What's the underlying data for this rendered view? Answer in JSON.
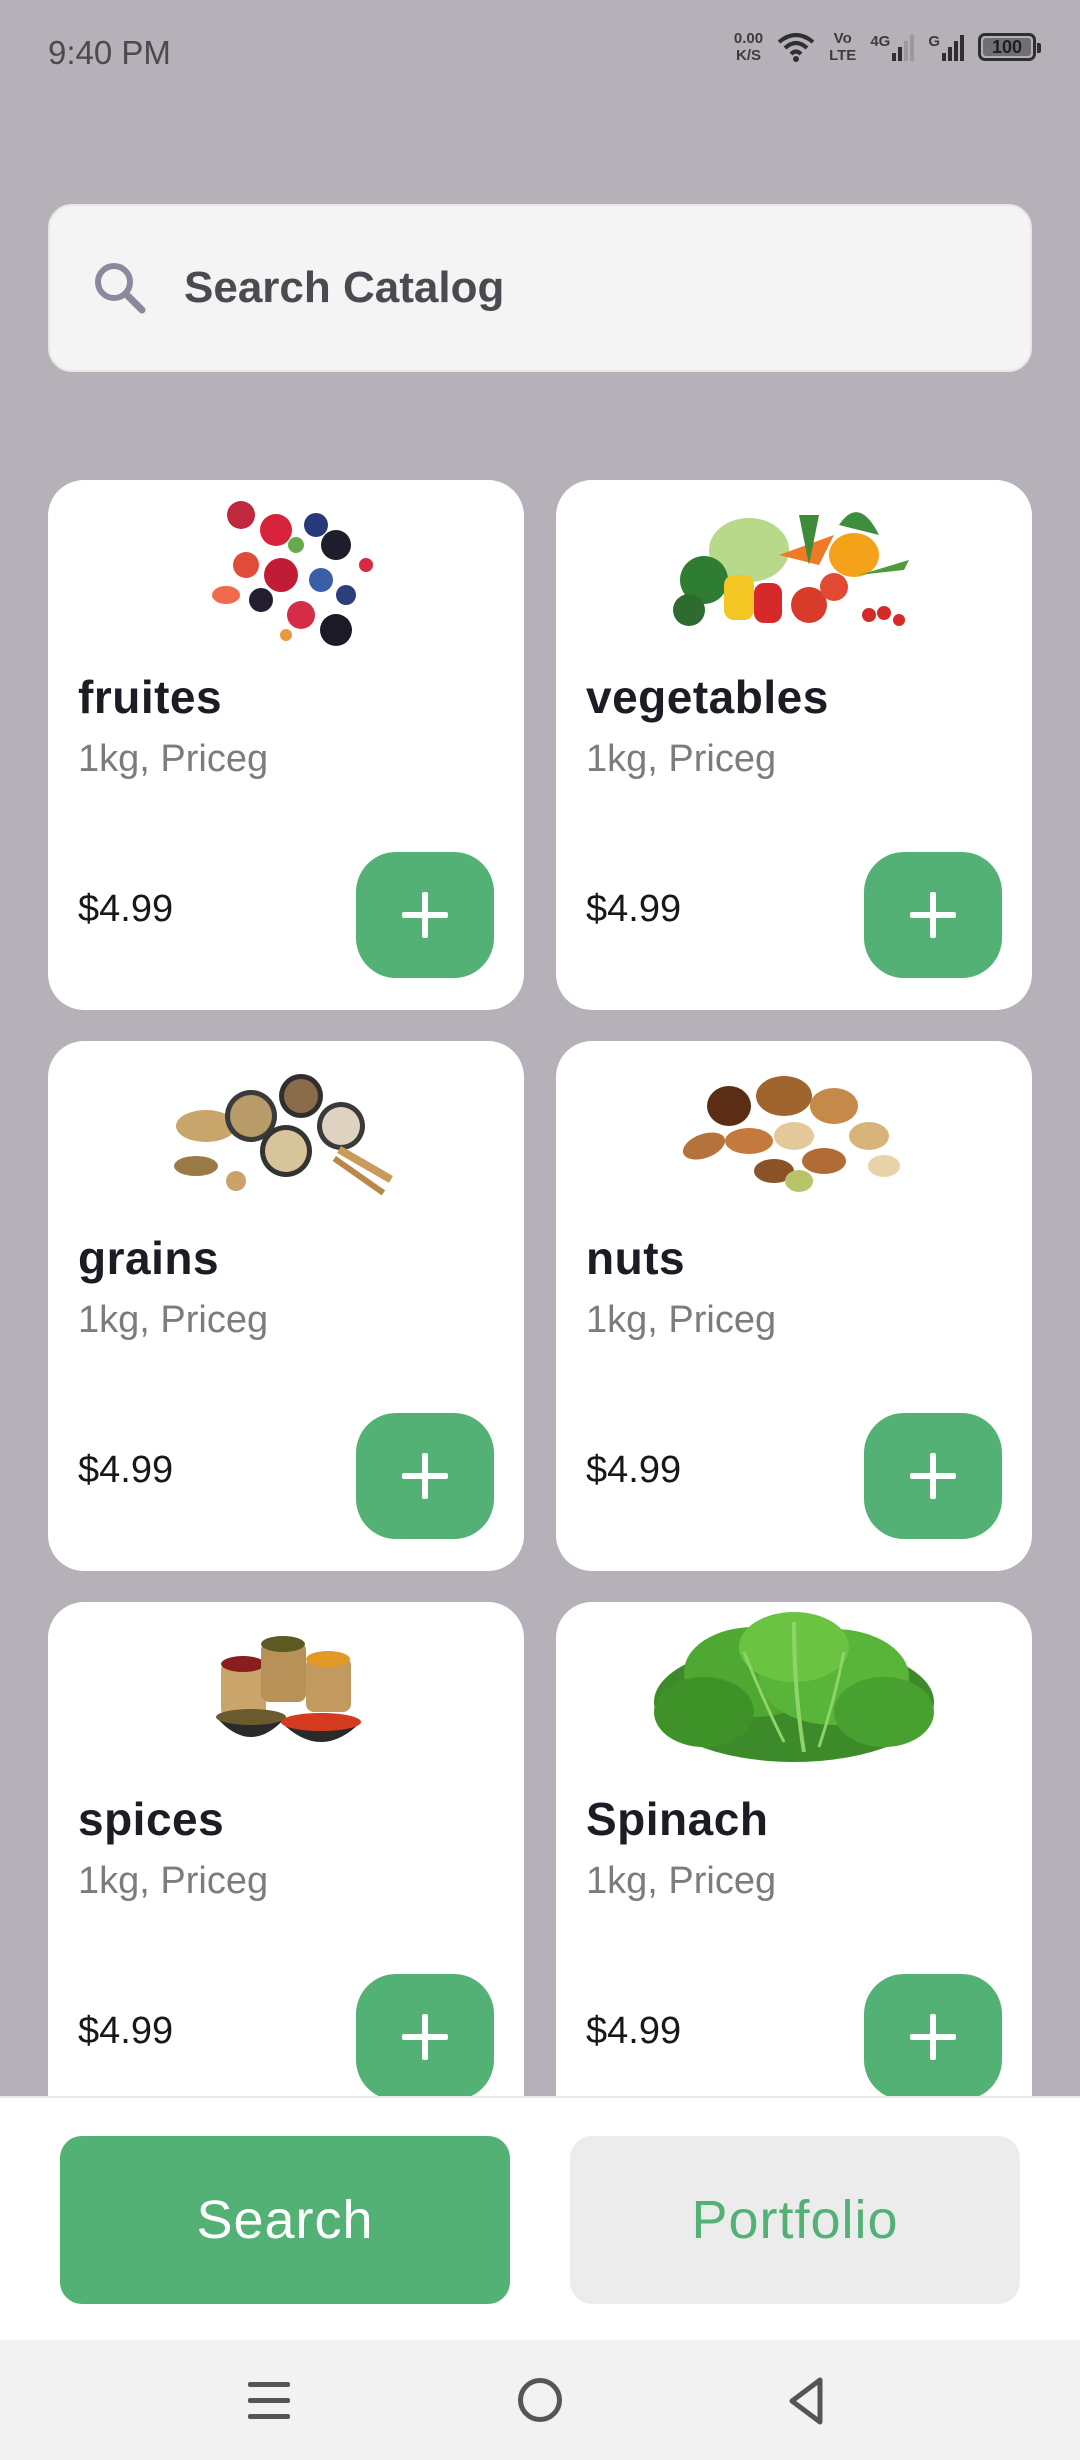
{
  "status_bar": {
    "time": "9:40 PM",
    "net_speed_value": "0.00",
    "net_speed_unit": "K/S",
    "volte_top": "Vo",
    "volte_bottom": "LTE",
    "network_4g": "4G",
    "network_g": "G",
    "battery": "100"
  },
  "search": {
    "placeholder": "Search Catalog",
    "icon": "search-icon"
  },
  "products": [
    {
      "name": "fruites",
      "unit": "1kg, Priceg",
      "price": "$4.99",
      "image": "mixed-berries-image"
    },
    {
      "name": "vegetables",
      "unit": "1kg, Priceg",
      "price": "$4.99",
      "image": "vegetables-image"
    },
    {
      "name": "grains",
      "unit": "1kg, Priceg",
      "price": "$4.99",
      "image": "grains-image"
    },
    {
      "name": "nuts",
      "unit": "1kg, Priceg",
      "price": "$4.99",
      "image": "nuts-image"
    },
    {
      "name": "spices",
      "unit": "1kg, Priceg",
      "price": "$4.99",
      "image": "spices-image"
    },
    {
      "name": "Spinach",
      "unit": "1kg, Priceg",
      "price": "$4.99",
      "image": "spinach-image"
    }
  ],
  "bottom_bar": {
    "search_label": "Search",
    "portfolio_label": "Portfolio"
  },
  "colors": {
    "accent": "#53b175",
    "background": "#b6b1b8",
    "card": "#ffffff"
  }
}
